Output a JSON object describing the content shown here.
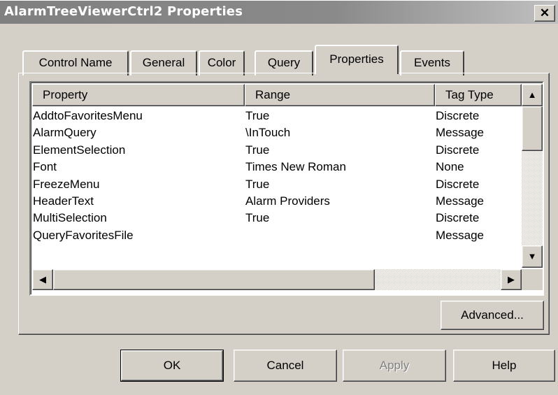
{
  "window": {
    "title": "AlarmTreeViewerCtrl2 Properties",
    "close_glyph": "✕"
  },
  "tabs": [
    {
      "label": "Control Name"
    },
    {
      "label": "General"
    },
    {
      "label": "Color"
    },
    {
      "label": "Query"
    },
    {
      "label": "Properties",
      "active": true
    },
    {
      "label": "Events"
    }
  ],
  "list": {
    "columns": [
      "Property",
      "Range",
      "Tag Type"
    ],
    "rows": [
      [
        "AddtoFavoritesMenu",
        "True",
        "Discrete"
      ],
      [
        "AlarmQuery",
        "\\InTouch",
        "Message"
      ],
      [
        "ElementSelection",
        "True",
        "Discrete"
      ],
      [
        "Font",
        "Times New Roman",
        "None"
      ],
      [
        "FreezeMenu",
        "True",
        "Discrete"
      ],
      [
        "HeaderText",
        "Alarm Providers",
        "Message"
      ],
      [
        "MultiSelection",
        "True",
        "Discrete"
      ],
      [
        "QueryFavoritesFile",
        "",
        "Message"
      ]
    ],
    "scroll_up_glyph": "▲",
    "scroll_down_glyph": "▼",
    "scroll_left_glyph": "◀",
    "scroll_right_glyph": "▶"
  },
  "buttons": {
    "advanced": "Advanced...",
    "ok": "OK",
    "cancel": "Cancel",
    "apply": "Apply",
    "help": "Help"
  },
  "colors": {
    "titlebar_inactive": "#808080",
    "face": "#d4d0c8"
  }
}
